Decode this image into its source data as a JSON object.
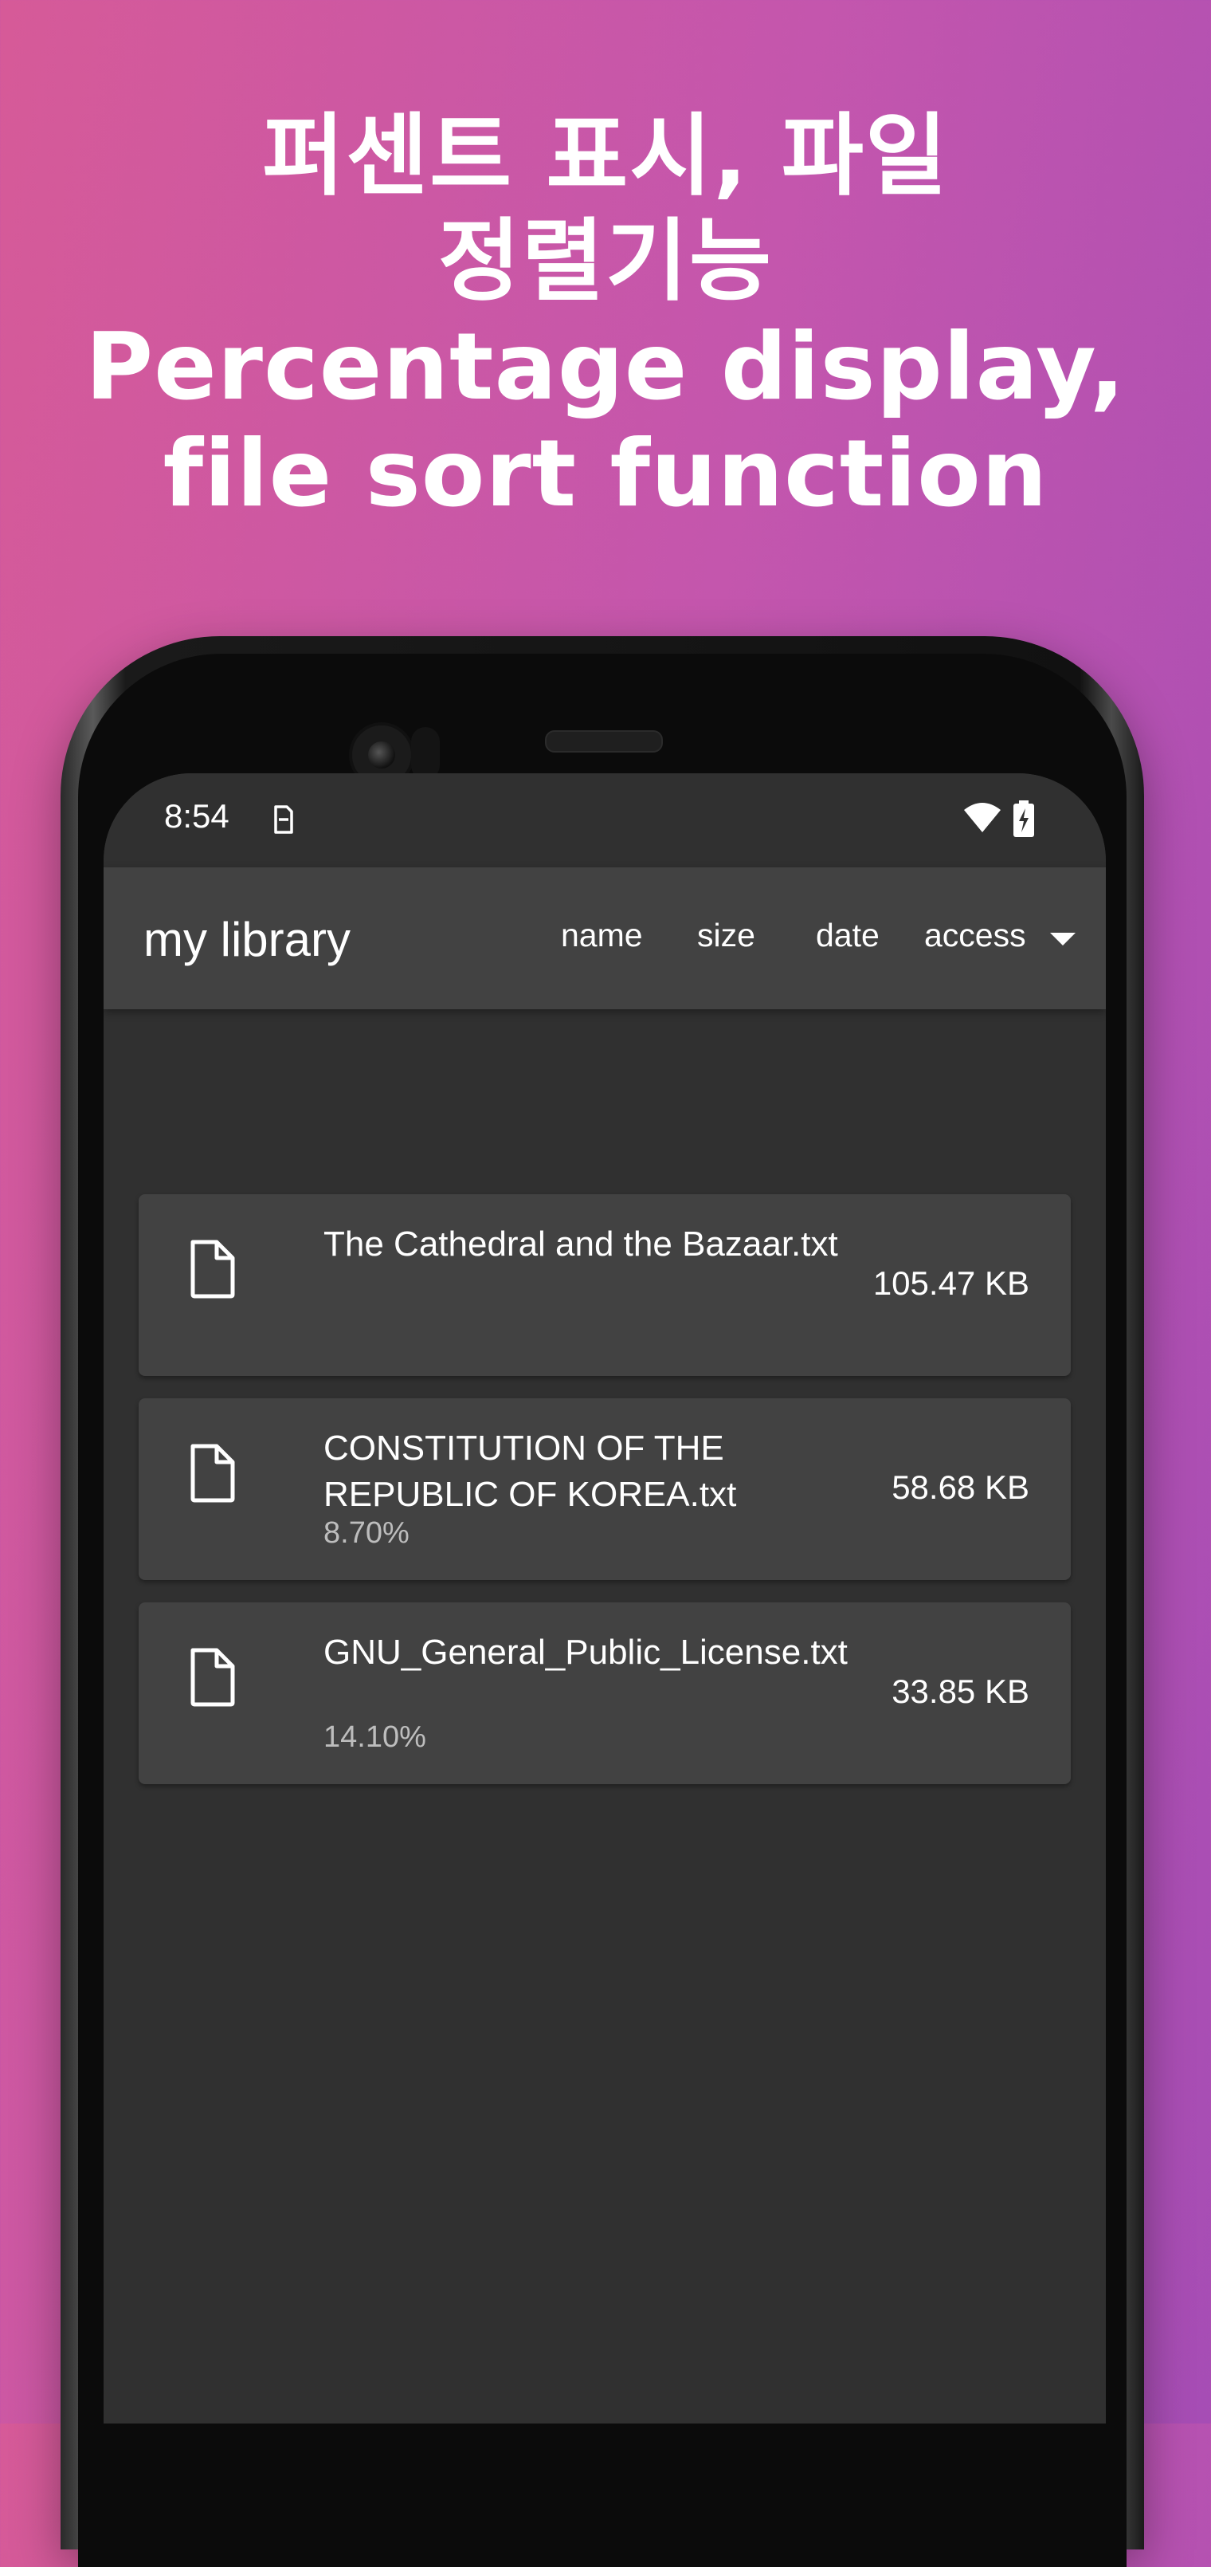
{
  "headline": {
    "ko_line1": "퍼센트 표시, 파일",
    "ko_line2": "정렬기능",
    "en_line1": "Percentage display,",
    "en_line2": "file sort function"
  },
  "status_bar": {
    "time": "8:54",
    "icons": [
      "sim-icon",
      "wifi-icon",
      "battery-charging-icon"
    ]
  },
  "app_bar": {
    "title": "my library",
    "sort_options": [
      "name",
      "size",
      "date",
      "access"
    ],
    "selected_sort": "access"
  },
  "files": [
    {
      "name": "The Cathedral and the Bazaar.txt",
      "size": "105.47 KB",
      "percent": ""
    },
    {
      "name": "CONSTITUTION OF THE REPUBLIC OF KOREA.txt",
      "size": "58.68 KB",
      "percent": "8.70%"
    },
    {
      "name": "GNU_General_Public_License.txt",
      "size": "33.85 KB",
      "percent": "14.10%"
    }
  ],
  "colors": {
    "background_gradient": [
      "#d65a98",
      "#a64db5"
    ],
    "screen_bg": "#303030",
    "app_bar_bg": "#424242",
    "card_bg": "#424242",
    "percent_text": "#bdbdbd"
  }
}
